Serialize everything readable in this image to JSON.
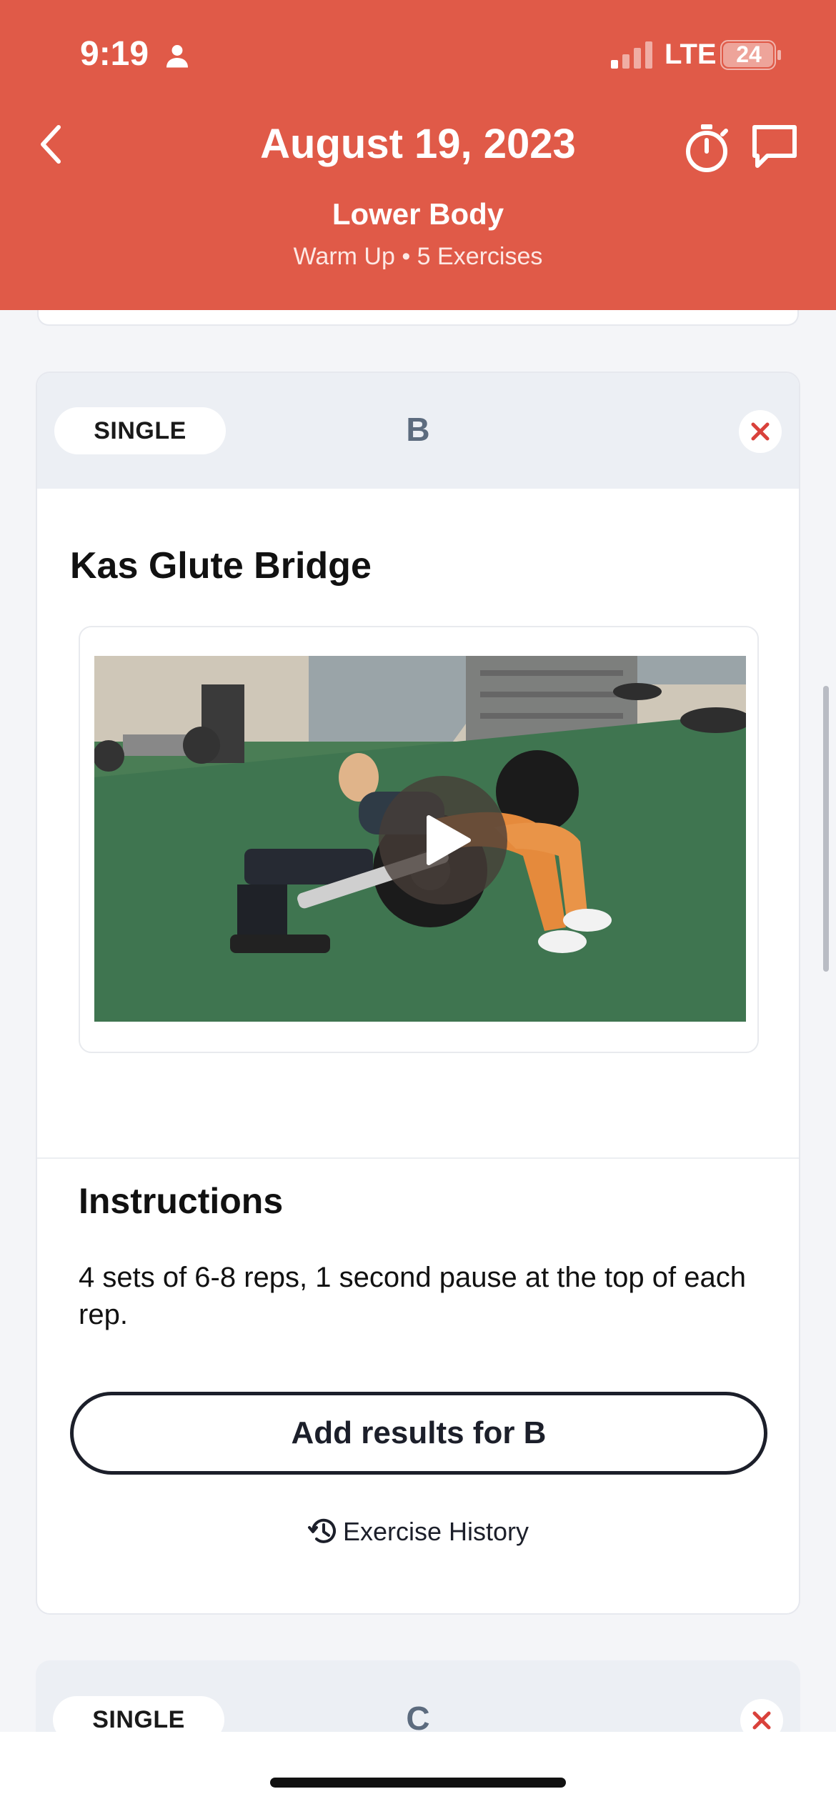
{
  "status_bar": {
    "time": "9:19",
    "network": "LTE",
    "battery": "24"
  },
  "header": {
    "title": "August 19, 2023",
    "workout_name": "Lower Body",
    "meta": "Warm Up • 5 Exercises",
    "background_color": "#e05a48"
  },
  "current_exercise": {
    "type_label": "SINGLE",
    "group": "B",
    "name": "Kas Glute Bridge",
    "instructions_heading": "Instructions",
    "instructions": "4 sets of 6-8 reps, 1 second pause at the top of each rep.",
    "add_results_label": "Add results for B",
    "history_label": "Exercise History"
  },
  "next_exercise": {
    "type_label": "SINGLE",
    "group": "C"
  },
  "icons": [
    "person-icon",
    "signal-icon",
    "battery-icon",
    "back-icon",
    "timer-icon",
    "chat-icon",
    "close-icon",
    "play-icon",
    "history-icon"
  ]
}
